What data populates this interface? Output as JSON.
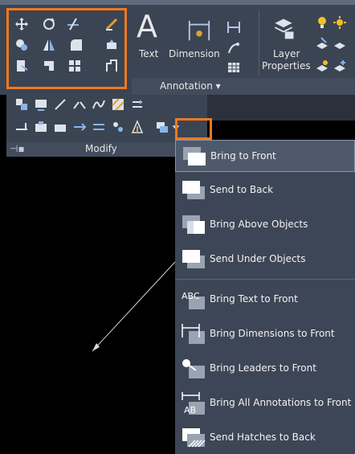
{
  "ribbon": {
    "text_label": "Text",
    "dimension_label": "Dimension",
    "layer_label_1": "Layer",
    "layer_label_2": "Properties",
    "annotation_panel": "Annotation ▾"
  },
  "modify_panel": {
    "title": "Modify"
  },
  "draw_order_menu": {
    "items": [
      {
        "label": "Bring to Front",
        "icon": "bring-to-front-icon"
      },
      {
        "label": "Send to Back",
        "icon": "send-to-back-icon"
      },
      {
        "label": "Bring Above Objects",
        "icon": "bring-above-objects-icon"
      },
      {
        "label": "Send Under Objects",
        "icon": "send-under-objects-icon"
      },
      {
        "label": "Bring Text to Front",
        "icon": "bring-text-to-front-icon"
      },
      {
        "label": "Bring Dimensions to Front",
        "icon": "bring-dimensions-to-front-icon"
      },
      {
        "label": "Bring Leaders to Front",
        "icon": "bring-leaders-to-front-icon"
      },
      {
        "label": "Bring All Annotations to Front",
        "icon": "bring-annotations-to-front-icon"
      },
      {
        "label": "Send Hatches to Back",
        "icon": "send-hatches-to-back-icon"
      }
    ],
    "icon_text_abc": "ABC",
    "icon_text_ab": "AB"
  },
  "colors": {
    "highlight": "#f0791f",
    "ribbon": "#3b4453",
    "canvas": "#000000"
  }
}
